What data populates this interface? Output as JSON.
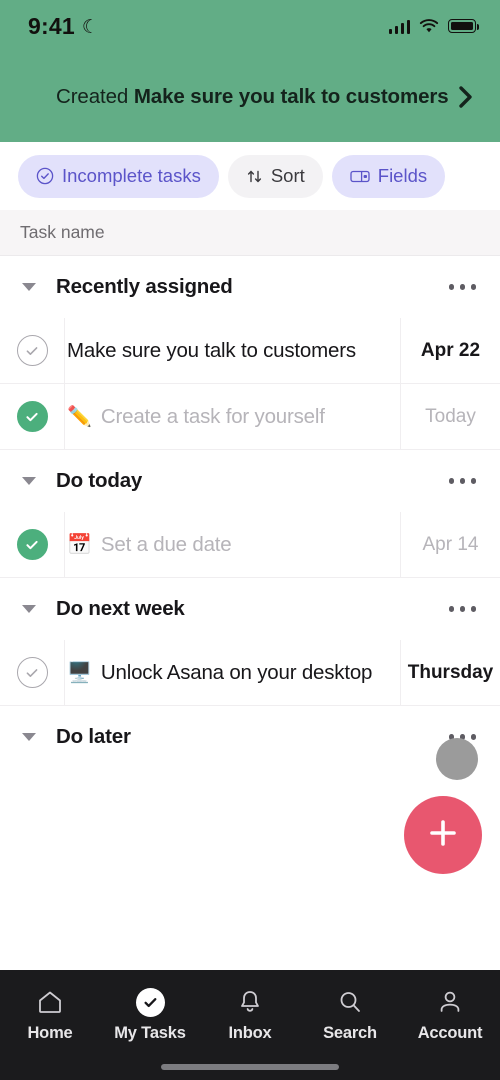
{
  "status_bar": {
    "time": "9:41",
    "dnd_icon": "moon-icon",
    "signal_icon": "cellular-signal-icon",
    "wifi_icon": "wifi-icon",
    "battery_icon": "battery-full-icon"
  },
  "header": {
    "background_color": "#62ad86",
    "banner_lead": "Created ",
    "banner_task": "Make sure you talk to customers",
    "chevron_icon": "chevron-right-icon"
  },
  "filters": {
    "chips": [
      {
        "label": "Incomplete tasks",
        "icon": "check-circle-icon",
        "style": "purple"
      },
      {
        "label": "Sort",
        "icon": "sort-arrows-icon",
        "style": "grey"
      },
      {
        "label": "Fields",
        "icon": "fields-columns-icon",
        "style": "purple"
      }
    ],
    "accent_purple_bg": "#e2e1fb",
    "accent_purple_fg": "#5b54c9"
  },
  "column_header": {
    "task_name": "Task name"
  },
  "sections": [
    {
      "title": "Recently assigned",
      "caret_icon": "caret-down-icon",
      "menu_icon": "overflow-menu-icon",
      "tasks": [
        {
          "title": "Make sure you talk to customers",
          "emoji": "",
          "date": "Apr 22",
          "completed": false
        },
        {
          "title": "Create a task for yourself",
          "emoji": "✏️",
          "date": "Today",
          "completed": true
        }
      ]
    },
    {
      "title": "Do today",
      "caret_icon": "caret-down-icon",
      "menu_icon": "overflow-menu-icon",
      "tasks": [
        {
          "title": "Set a due date",
          "emoji": "📅",
          "date": "Apr 14",
          "completed": true
        }
      ]
    },
    {
      "title": "Do next week",
      "caret_icon": "caret-down-icon",
      "menu_icon": "overflow-menu-icon",
      "tasks": [
        {
          "title": "Unlock Asana on your desktop",
          "emoji": "🖥️",
          "date": "Thursday",
          "completed": false
        }
      ]
    },
    {
      "title": "Do later",
      "caret_icon": "caret-down-icon",
      "menu_icon": "overflow-menu-icon",
      "tasks": []
    }
  ],
  "floating": {
    "avatar_icon": "user-avatar-placeholder",
    "fab_icon": "plus-icon",
    "fab_color": "#e8576f",
    "avatar_color": "#9b9b9b"
  },
  "bottom_nav": {
    "items": [
      {
        "label": "Home",
        "icon": "home-icon",
        "active": false
      },
      {
        "label": "My Tasks",
        "icon": "check-circle-filled-icon",
        "active": true
      },
      {
        "label": "Inbox",
        "icon": "bell-icon",
        "active": false
      },
      {
        "label": "Search",
        "icon": "search-icon",
        "active": false
      },
      {
        "label": "Account",
        "icon": "person-icon",
        "active": false
      }
    ]
  }
}
